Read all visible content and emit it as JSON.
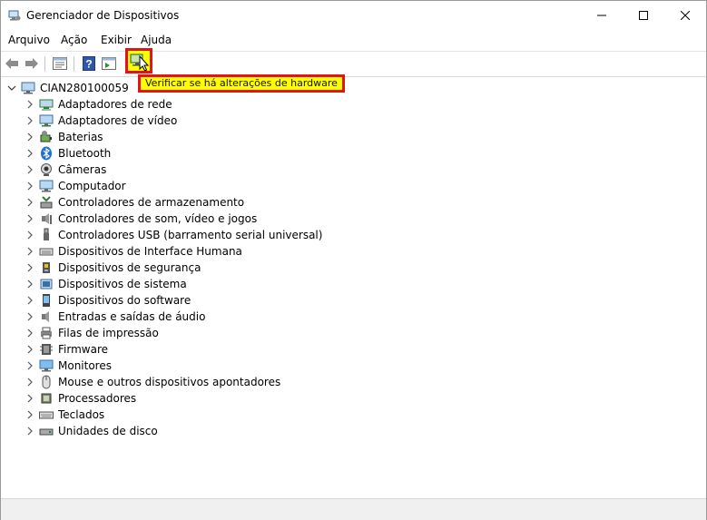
{
  "window": {
    "title": "Gerenciador de Dispositivos"
  },
  "menu": [
    "Arquivo",
    "Ação",
    "Exibir",
    "Ajuda"
  ],
  "toolbar": {
    "tooltip": "Verificar se há alterações de hardware"
  },
  "tree": {
    "root": "CIAN280100059",
    "items": [
      {
        "label": "Adaptadores de rede",
        "icon": "network-adapter-icon"
      },
      {
        "label": "Adaptadores de vídeo",
        "icon": "display-adapter-icon"
      },
      {
        "label": "Baterias",
        "icon": "battery-icon"
      },
      {
        "label": "Bluetooth",
        "icon": "bluetooth-icon"
      },
      {
        "label": "Câmeras",
        "icon": "camera-icon"
      },
      {
        "label": "Computador",
        "icon": "computer-icon"
      },
      {
        "label": "Controladores de armazenamento",
        "icon": "storage-controller-icon"
      },
      {
        "label": "Controladores de som, vídeo e jogos",
        "icon": "sound-icon"
      },
      {
        "label": "Controladores USB (barramento serial universal)",
        "icon": "usb-icon"
      },
      {
        "label": "Dispositivos de Interface Humana",
        "icon": "hid-icon"
      },
      {
        "label": "Dispositivos de segurança",
        "icon": "security-device-icon"
      },
      {
        "label": "Dispositivos de sistema",
        "icon": "system-device-icon"
      },
      {
        "label": "Dispositivos do software",
        "icon": "software-device-icon"
      },
      {
        "label": "Entradas e saídas de áudio",
        "icon": "audio-io-icon"
      },
      {
        "label": "Filas de impressão",
        "icon": "print-queue-icon"
      },
      {
        "label": "Firmware",
        "icon": "firmware-icon"
      },
      {
        "label": "Monitores",
        "icon": "monitor-icon"
      },
      {
        "label": "Mouse e outros dispositivos apontadores",
        "icon": "mouse-icon"
      },
      {
        "label": "Processadores",
        "icon": "processor-icon"
      },
      {
        "label": "Teclados",
        "icon": "keyboard-icon"
      },
      {
        "label": "Unidades de disco",
        "icon": "disk-drive-icon"
      }
    ]
  }
}
